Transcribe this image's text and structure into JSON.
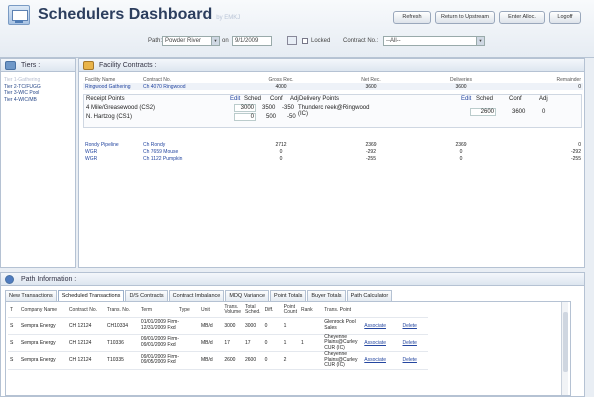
{
  "header": {
    "title": "Schedulers Dashboard",
    "by_user": "by EMKJ",
    "buttons": [
      "Refresh",
      "Return to Upstream",
      "Enter Alloc.",
      "Logoff"
    ]
  },
  "path_bar": {
    "path_label": "Path:",
    "path_value": "Powder River",
    "on_label": "on",
    "date_value": "9/1/2009",
    "locked_label": "Locked",
    "contract_label": "Contract No.:",
    "contract_value": "--All--"
  },
  "tiers": {
    "title": "Tiers :",
    "items": [
      "Tier 1-Gathering",
      "Tier 2-TC/FUGG",
      "Tier 3-WIC Pool",
      "Tier 4-WIC/MB"
    ]
  },
  "facility": {
    "title": "Facility Contracts :",
    "columns": [
      "Facility Name",
      "Contract No.",
      "Gross Rec.",
      "Net Rec.",
      "Deliveries",
      "Remainder"
    ],
    "top_row": {
      "facility": "Ringwood Gathering",
      "contract": "Ch 4070 Ringwood",
      "gross": "4000",
      "net": "3600",
      "deliveries": "3600",
      "remainder": "0"
    },
    "receipt": {
      "receipt_header": "Receipt Points",
      "edit": "Edit",
      "sched_h": "Sched",
      "conf_h": "Conf",
      "adj_h": "Adj",
      "delivery_header": "Delivery Points",
      "rows": [
        {
          "point": "4 Mile/Greasewood (CS2)",
          "sched": "3000",
          "conf": "3500",
          "adj": "-350"
        },
        {
          "point": "N. Hartzog (CS1)",
          "sched": "0",
          "conf": "500",
          "adj": "-50"
        }
      ],
      "delivery_point": "Thunderc reek@Ringwood (IC)",
      "d_sched": "2600",
      "d_conf": "3600",
      "d_adj": "0"
    },
    "rows": [
      {
        "facility": "Rondy Pipeline",
        "contract": "Ch Rondy",
        "gross": "2712",
        "net": "2369",
        "deliveries": "2369",
        "remainder": "0"
      },
      {
        "facility": "WGR",
        "contract": "Ch 7659 Mouse",
        "gross": "0",
        "net": "-292",
        "deliveries": "0",
        "remainder": "-292"
      },
      {
        "facility": "WGR",
        "contract": "Ch 1122 Pumpkin",
        "gross": "0",
        "net": "-255",
        "deliveries": "0",
        "remainder": "-255"
      }
    ]
  },
  "path_info": {
    "title": "Path Information :",
    "tabs": [
      "New Transactions",
      "Scheduled Transactions",
      "D/S Contracts",
      "Contract Imbalance",
      "MDQ Variance",
      "Point Totals",
      "Buyer Totals",
      "Path Calculator"
    ],
    "active_tab": 1,
    "columns": [
      "T",
      "Company Name",
      "Contract No.",
      "Trans. No.",
      "Term",
      "Type",
      "Unit",
      "Trans. Volume",
      "Total Sched.",
      "Diff.",
      "Point Count",
      "Rank",
      "Trans. Point",
      "",
      ""
    ],
    "rows": [
      {
        "t": "S",
        "company": "Sempra Energy",
        "contract": "CH 12124",
        "trans": "CH10334",
        "term": "01/01/2009 Firm- 12/31/2009 Fxd",
        "unit": "MB/d",
        "volume": "3000",
        "sched": "3000",
        "diff": "0",
        "count": "1",
        "rank": "",
        "point": "Glenrock Pool Sales",
        "associate": "Associate",
        "delete": "Delete"
      },
      {
        "t": "S",
        "company": "Sempra Energy",
        "contract": "CH 12124",
        "trans": "T10336",
        "term": "09/01/2009 Firm- 09/01/2009 Fxd",
        "unit": "MB/d",
        "volume": "17",
        "sched": "17",
        "diff": "0",
        "count": "1",
        "rank": "1",
        "point": "Cheyenne Plains@Curley CUR (IC)",
        "associate": "Associate",
        "delete": "Delete"
      },
      {
        "t": "S",
        "company": "Sempra Energy",
        "contract": "CH 12124",
        "trans": "T10335",
        "term": "09/01/2009 Firm- 09/05/2009 Fxd",
        "unit": "MB/d",
        "volume": "2600",
        "sched": "2600",
        "diff": "0",
        "count": "2",
        "rank": "",
        "point": "Cheyenne Plains@Curley CUR (IC)",
        "associate": "Associate",
        "delete": "Delete"
      }
    ]
  }
}
